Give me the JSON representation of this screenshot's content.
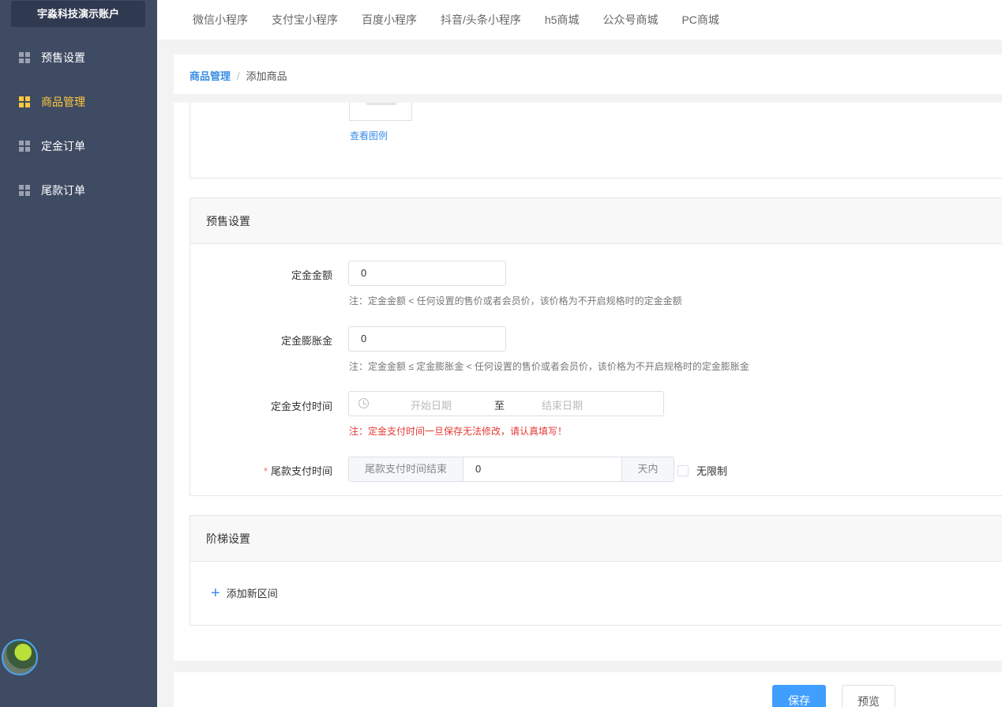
{
  "sidebar": {
    "account": "宇淼科技演示账户",
    "items": [
      {
        "label": "预售设置",
        "icon": "grid-icon",
        "active": false
      },
      {
        "label": "商品管理",
        "icon": "grid-icon",
        "active": true
      },
      {
        "label": "定金订单",
        "icon": "grid-icon",
        "active": false
      },
      {
        "label": "尾款订单",
        "icon": "grid-icon",
        "active": false
      }
    ]
  },
  "topbar": {
    "tabs": [
      "微信小程序",
      "支付宝小程序",
      "百度小程序",
      "抖音/头条小程序",
      "h5商城",
      "公众号商城",
      "PC商城"
    ]
  },
  "breadcrumb": {
    "parent": "商品管理",
    "separator": "/",
    "current": "添加商品"
  },
  "image_section": {
    "example_link": "查看图例"
  },
  "presale": {
    "title": "预售设置",
    "deposit_amount": {
      "label": "定金金额",
      "value": "0",
      "note": "注：定金金额 < 任何设置的售价或者会员价，该价格为不开启规格时的定金金额"
    },
    "deposit_swell": {
      "label": "定金膨胀金",
      "value": "0",
      "note": "注：定金金额 ≤ 定金膨胀金 < 任何设置的售价或者会员价，该价格为不开启规格时的定金膨胀金"
    },
    "deposit_time": {
      "label": "定金支付时间",
      "start_placeholder": "开始日期",
      "separator": "至",
      "end_placeholder": "结束日期",
      "note": "注：定金支付时间一旦保存无法修改，请认真填写！"
    },
    "balance_time": {
      "required_mark": "*",
      "label": "尾款支付时间",
      "prepend": "尾款支付时间结束",
      "value": "0",
      "append": "天内",
      "unlimited_label": "无限制",
      "unlimited_checked": false
    }
  },
  "ladder": {
    "title": "阶梯设置",
    "add_label": "添加新区间"
  },
  "footer": {
    "save_label": "保存",
    "preview_label": "预览"
  },
  "colors": {
    "sidebar_bg": "#3f4a63",
    "active": "#ffc93c",
    "primary": "#409eff",
    "link": "#3a8ee6",
    "warning_note": "#e53935"
  }
}
